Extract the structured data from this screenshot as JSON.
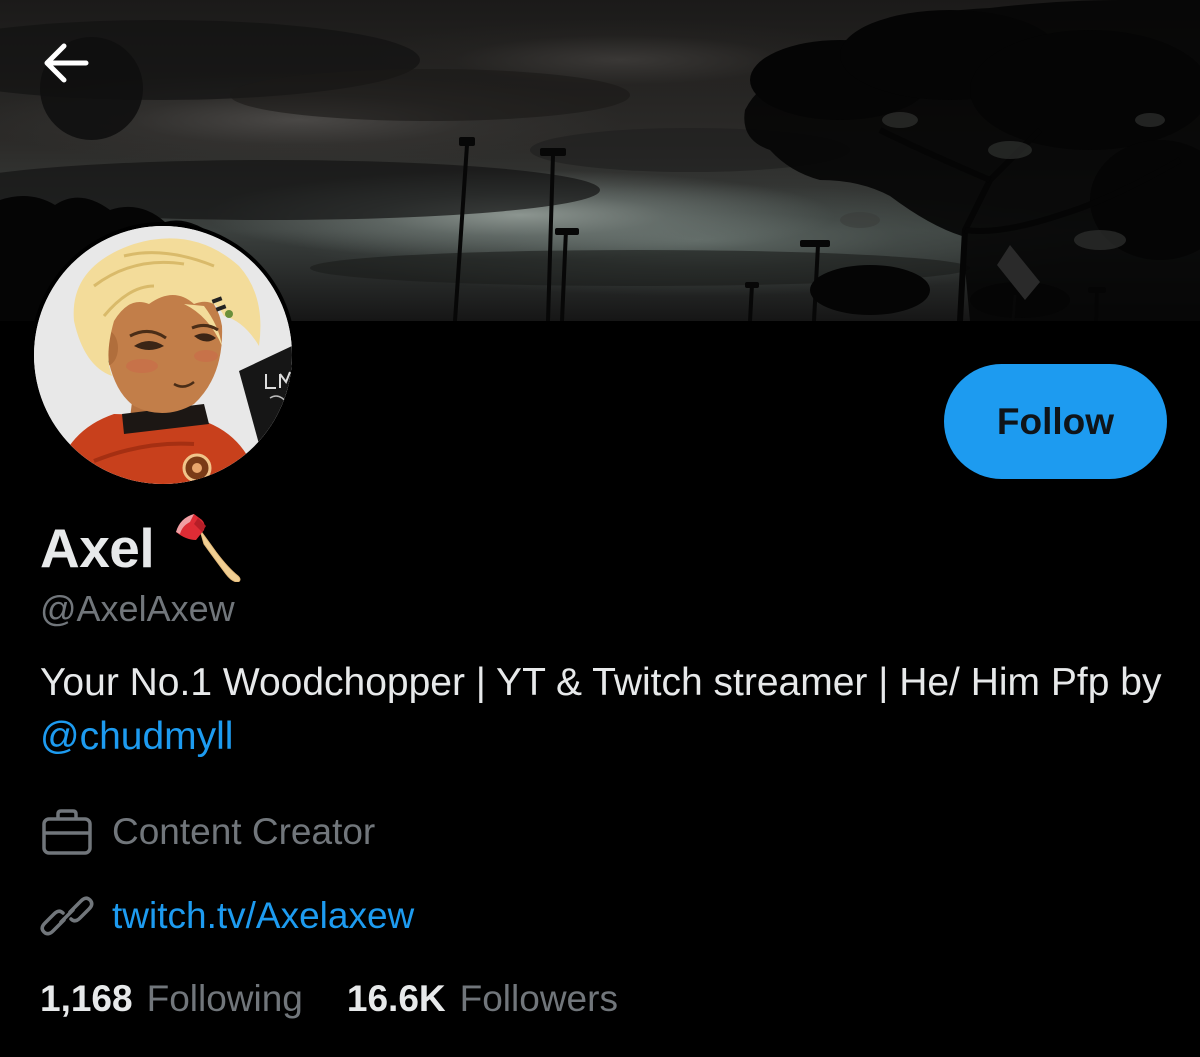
{
  "header": {
    "back_icon": "arrow-left-icon"
  },
  "profile": {
    "display_name": "Axel",
    "name_emoji": "axe-emoji",
    "handle": "@AxelAxew",
    "bio_text": "Your No.1 Woodchopper | YT & Twitch streamer | He/ Him Pfp by ",
    "bio_mention": "@chudmyll",
    "category_icon": "briefcase-icon",
    "category": "Content Creator",
    "link_icon": "link-icon",
    "link": "twitch.tv/Axelaxew"
  },
  "actions": {
    "follow_label": "Follow"
  },
  "stats": {
    "following_count": "1,168",
    "following_label": "Following",
    "followers_count": "16.6K",
    "followers_label": "Followers"
  },
  "colors": {
    "accent": "#1d9bf0",
    "background": "#000000",
    "primary_text": "#e7e9ea",
    "secondary_text": "#71767b"
  }
}
